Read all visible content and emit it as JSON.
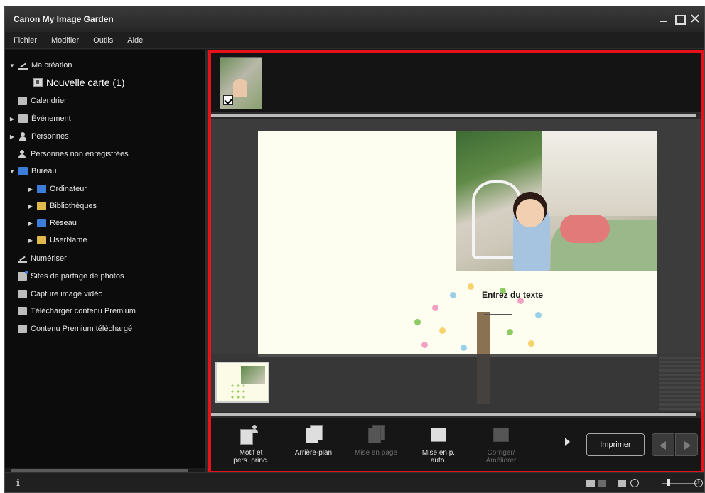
{
  "window": {
    "title": "Canon My Image Garden"
  },
  "menu": {
    "items": [
      "Fichier",
      "Modifier",
      "Outils",
      "Aide"
    ]
  },
  "sidebar": {
    "items": [
      {
        "label": "Ma création",
        "expanded": true,
        "icon": "creation-icon"
      },
      {
        "label": "Nouvelle carte (1)",
        "selected": true,
        "icon": "card-icon"
      },
      {
        "label": "Calendrier",
        "icon": "calendar-icon"
      },
      {
        "label": "Événement",
        "icon": "event-icon"
      },
      {
        "label": "Personnes",
        "icon": "people-icon"
      },
      {
        "label": "Personnes non enregistrées",
        "icon": "unregistered-people-icon"
      },
      {
        "label": "Bureau",
        "expanded": true,
        "icon": "desktop-icon"
      },
      {
        "label": "Ordinateur",
        "icon": "computer-icon"
      },
      {
        "label": "Bibliothèques",
        "icon": "libraries-icon"
      },
      {
        "label": "Réseau",
        "icon": "network-icon"
      },
      {
        "label": "UserName",
        "icon": "user-folder-icon"
      },
      {
        "label": "Numériser",
        "icon": "scan-icon"
      },
      {
        "label": "Sites de partage de photos",
        "icon": "photo-sharing-icon"
      },
      {
        "label": "Capture image vidéo",
        "icon": "video-capture-icon"
      },
      {
        "label": "Télécharger contenu Premium",
        "icon": "download-premium-icon"
      },
      {
        "label": "Contenu Premium téléchargé",
        "icon": "downloaded-premium-icon"
      }
    ]
  },
  "card": {
    "text": "Entrez du texte"
  },
  "toolbar": {
    "motif_label_line1": "Motif et",
    "motif_label_line2": "pers. princ.",
    "background_label": "Arrière-plan",
    "layout_label": "Mise en page",
    "auto_layout_line1": "Mise en p.",
    "auto_layout_line2": "auto.",
    "correct_line1": "Corriger/",
    "correct_line2": "Améliorer",
    "print_label": "Imprimer"
  },
  "colors": {
    "highlight": "#e8131a",
    "window_bg": "#1b1b1b",
    "sidebar_bg": "#0c0c0c"
  }
}
